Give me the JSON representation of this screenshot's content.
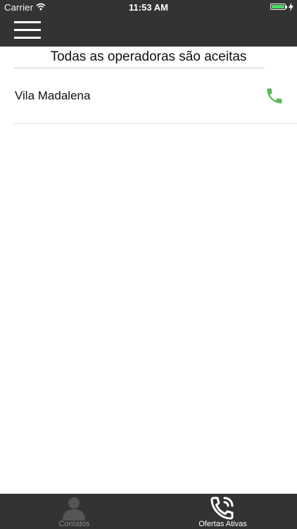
{
  "status_bar": {
    "carrier": "Carrier",
    "time": "11:53 AM",
    "battery_color": "#4cd964"
  },
  "nav": {
    "menu_icon": "hamburger-menu-icon"
  },
  "banner": {
    "text": "Todas as operadoras são aceitas"
  },
  "list": {
    "items": [
      {
        "name": "Vila Madalena",
        "action_icon": "phone-icon",
        "action_color": "#5cb85c"
      }
    ]
  },
  "tab_bar": {
    "tabs": [
      {
        "label": "Contatos",
        "icon": "person-icon",
        "active": false
      },
      {
        "label": "Ofertas Ativas",
        "icon": "phone-call-icon",
        "active": true
      }
    ]
  },
  "colors": {
    "bar_background": "#333333",
    "tab_active": "#ffffff",
    "tab_inactive": "#8a8a8a"
  }
}
